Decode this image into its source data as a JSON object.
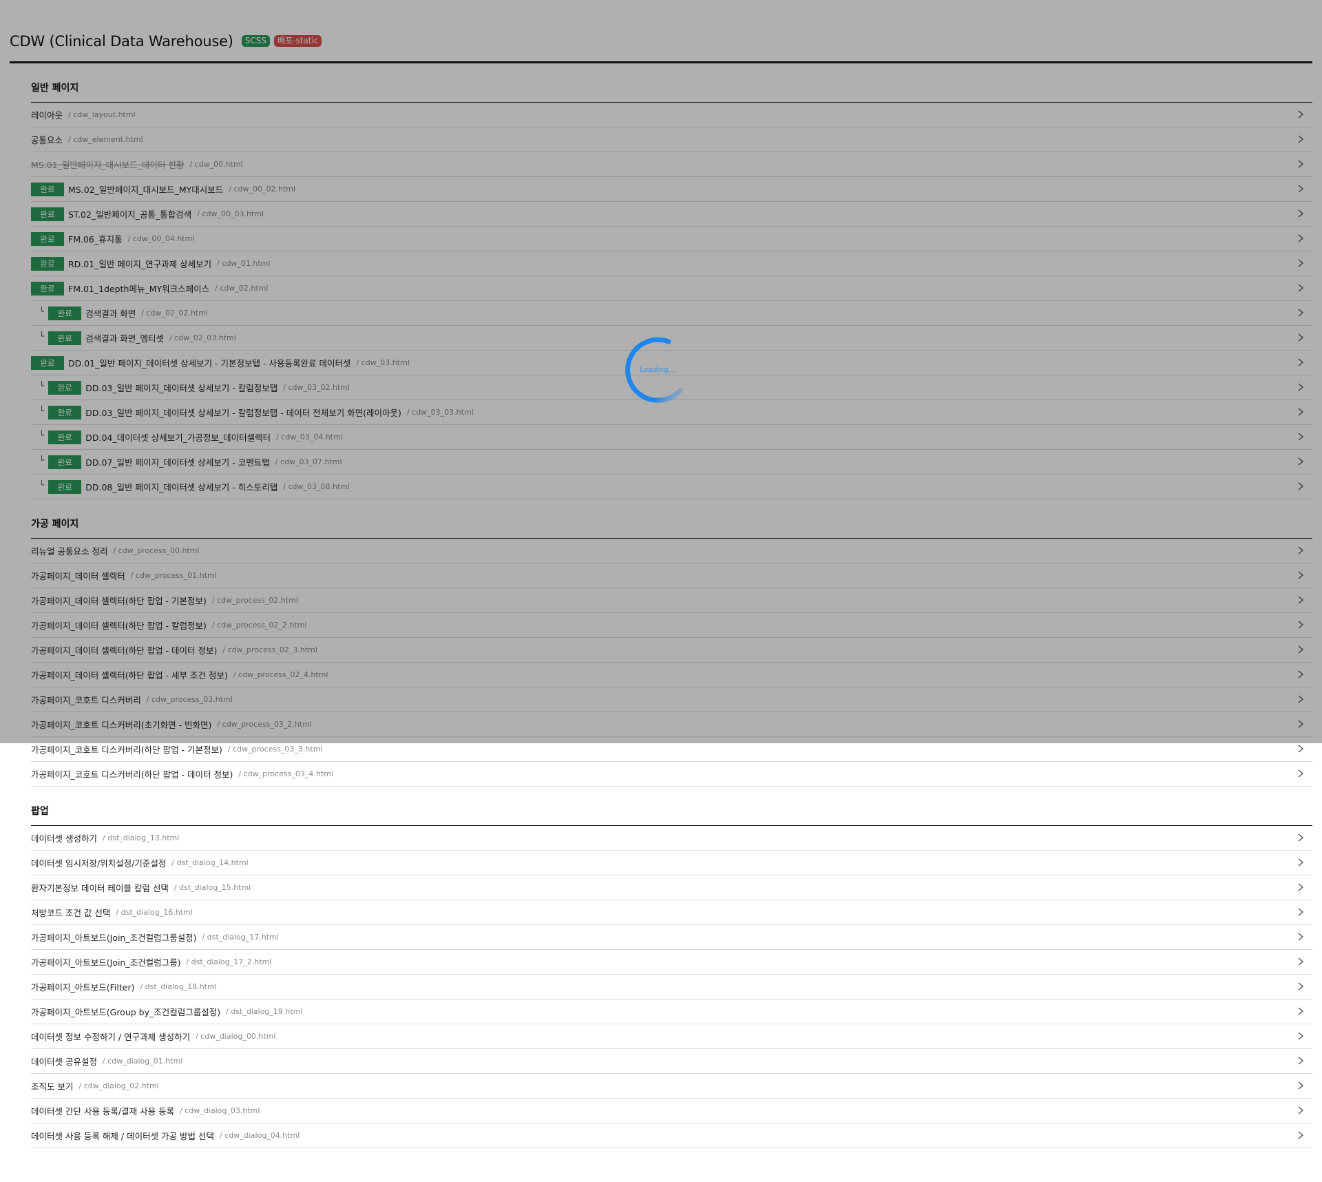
{
  "header": {
    "title": "CDW (Clinical Data Warehouse)",
    "badges": [
      {
        "label": "SCSS",
        "color": "#2b9a5c"
      },
      {
        "label": "배포-static",
        "color": "#d84f4f"
      }
    ]
  },
  "sections": [
    {
      "title": "일반 페이지",
      "items": [
        {
          "name": "레이아웃",
          "path": "/ cdw_layout.html"
        },
        {
          "name": "공통요소",
          "path": "/ cdw_element.html"
        },
        {
          "name": "MS.01_일반페이지_대시보드_데이터 현황",
          "path": "/ cdw_00.html",
          "struck": true
        },
        {
          "status": "완료",
          "name": "MS.02_일반페이지_대시보드_MY대시보드",
          "path": "/ cdw_00_02.html"
        },
        {
          "status": "완료",
          "name": "ST.02_일반페이지_공통_통합검색",
          "path": "/ cdw_00_03.html"
        },
        {
          "status": "완료",
          "name": "FM.06_휴지통",
          "path": "/ cdw_00_04.html"
        },
        {
          "status": "완료",
          "name": "RD.01_일반 페이지_연구과제 상세보기",
          "path": "/ cdw_01.html"
        },
        {
          "status": "완료",
          "name": "FM.01_1depth메뉴_MY워크스페이스",
          "path": "/ cdw_02.html"
        },
        {
          "sub": "└",
          "status": "완료",
          "name": "검색결과 화면",
          "path": "/ cdw_02_02.html"
        },
        {
          "sub": "└",
          "status": "완료",
          "name": "검색결과 화면_엠티셋",
          "path": "/ cdw_02_03.html"
        },
        {
          "status": "완료",
          "name": "DD.01_일반 페이지_데이터셋 상세보기 - 기본정보탭 - 사용등록완료 데이터셋",
          "path": "/ cdw_03.html"
        },
        {
          "sub": "└",
          "status": "완료",
          "name": "DD.03_일반 페이지_데이터셋 상세보기 - 칼럼정보탭",
          "path": "/ cdw_03_02.html"
        },
        {
          "sub": "└",
          "status": "완료",
          "name": "DD.03_일반 페이지_데이터셋 상세보기 - 칼럼정보탭 - 데이터 전체보기 화면(레이아웃)",
          "path": "/ cdw_03_03.html"
        },
        {
          "sub": "└",
          "status": "완료",
          "name": "DD.04_데이터셋 상세보기_가공정보_데이터셀렉터",
          "path": "/ cdw_03_04.html"
        },
        {
          "sub": "└",
          "status": "완료",
          "name": "DD.07_일반 페이지_데이터셋 상세보기 - 코멘트탭",
          "path": "/ cdw_03_07.html"
        },
        {
          "sub": "└",
          "status": "완료",
          "name": "DD.08_일반 페이지_데이터셋 상세보기 - 히스토리탭",
          "path": "/ cdw_03_08.html"
        }
      ]
    },
    {
      "title": "가공 페이지",
      "items": [
        {
          "name": "리뉴얼 공통요소 정리",
          "path": "/ cdw_process_00.html"
        },
        {
          "name": "가공페이지_데이터 셀렉터",
          "path": "/ cdw_process_01.html"
        },
        {
          "name": "가공페이지_데이터 셀렉터(하단 팝업 - 기본정보)",
          "path": "/ cdw_process_02.html"
        },
        {
          "name": "가공페이지_데이터 셀렉터(하단 팝업 - 칼럼정보)",
          "path": "/ cdw_process_02_2.html"
        },
        {
          "name": "가공페이지_데이터 셀렉터(하단 팝업 - 데이터 정보)",
          "path": "/ cdw_process_02_3.html"
        },
        {
          "name": "가공페이지_데이터 셀렉터(하단 팝업 - 세부 조건 정보)",
          "path": "/ cdw_process_02_4.html"
        },
        {
          "name": "가공페이지_코호트 디스커버리",
          "path": "/ cdw_process_03.html"
        },
        {
          "name": "가공페이지_코호트 디스커버리(초기화면 - 빈화면)",
          "path": "/ cdw_process_03_2.html"
        },
        {
          "name": "가공페이지_코호트 디스커버리(하단 팝업 - 기본정보)",
          "path": "/ cdw_process_03_3.html"
        },
        {
          "name": "가공페이지_코호트 디스커버리(하단 팝업 - 데이터 정보)",
          "path": "/ cdw_process_03_4.html"
        }
      ]
    },
    {
      "title": "팝업",
      "items": [
        {
          "name": "데이터셋 생성하기",
          "path": "/ dst_dialog_13.html"
        },
        {
          "name": "데이터셋 임시저장/위치설정/기준설정",
          "path": "/ dst_dialog_14.html"
        },
        {
          "name": "환자기본정보 데이터 테이블 칼럼 선택",
          "path": "/ dst_dialog_15.html"
        },
        {
          "name": "처방코드 조건 값 선택",
          "path": "/ dst_dialog_16.html"
        },
        {
          "name": "가공페이지_아트보드(Join_조건컬럼그룹설정)",
          "path": "/ dst_dialog_17.html"
        },
        {
          "name": "가공페이지_아트보드(Join_조건컬럼그룹)",
          "path": "/ dst_dialog_17_2.html"
        },
        {
          "name": "가공페이지_아트보드(Filter)",
          "path": "/ dst_dialog_18.html"
        },
        {
          "name": "가공페이지_아트보드(Group by_조건컬럼그룹설정)",
          "path": "/ dst_dialog_19.html"
        },
        {
          "name": "데이터셋 정보 수정하기 / 연구과제 생성하기",
          "path": "/ cdw_dialog_00.html"
        },
        {
          "name": "데이터셋 공유설정",
          "path": "/ cdw_dialog_01.html"
        },
        {
          "name": "조직도 보기",
          "path": "/ cdw_dialog_02.html"
        },
        {
          "name": "데이터셋 간단 사용 등록/결재 사용 등록",
          "path": "/ cdw_dialog_03.html"
        },
        {
          "name": "데이터셋 사용 등록 해제 / 데이터셋 가공 방법 선택",
          "path": "/ cdw_dialog_04.html"
        }
      ]
    }
  ],
  "loader": {
    "text": "Loading...",
    "color": "#2e8ff0"
  },
  "icons": {
    "row_arrow": "chevron-right-icon"
  }
}
